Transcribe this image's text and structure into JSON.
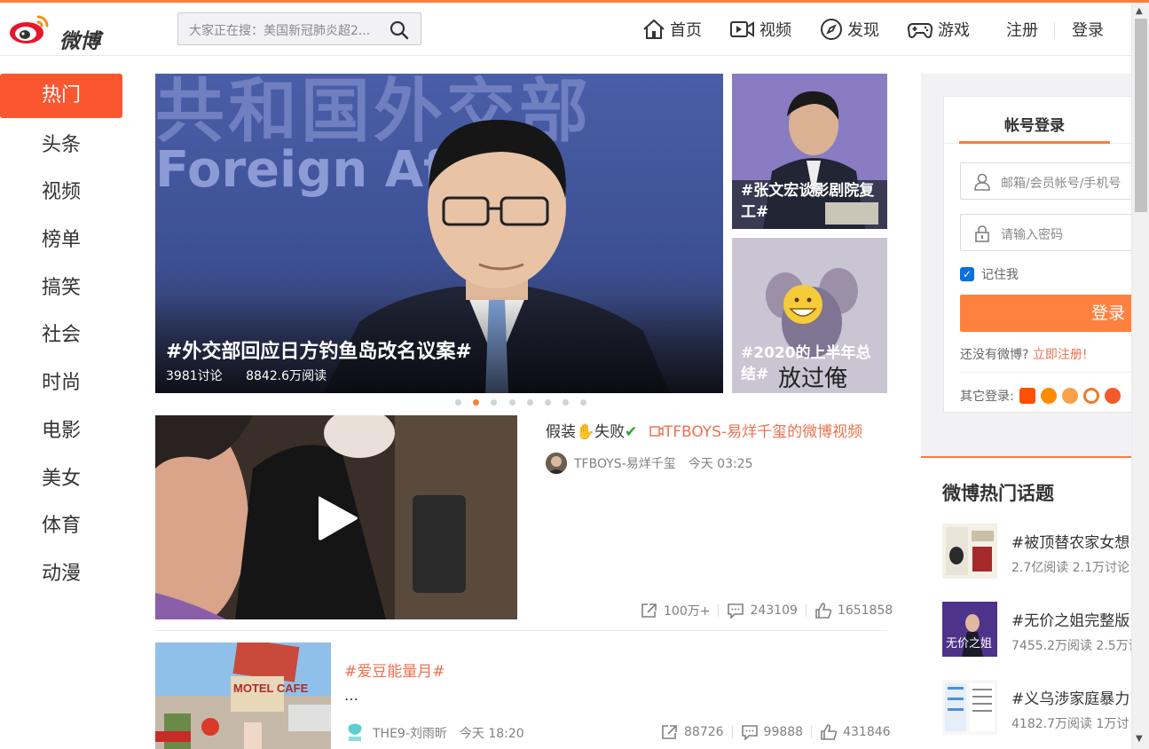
{
  "logo": {
    "text": "微博"
  },
  "search": {
    "placeholder": "大家正在搜：美国新冠肺炎超2..."
  },
  "nav": {
    "home": "首页",
    "video": "视频",
    "discover": "发现",
    "game": "游戏",
    "register": "注册",
    "login": "登录"
  },
  "left_nav": [
    "热门",
    "头条",
    "视频",
    "榜单",
    "搞笑",
    "社会",
    "时尚",
    "电影",
    "美女",
    "体育",
    "动漫"
  ],
  "hero": {
    "main_title": "#外交部回应日方钓鱼岛改名议案#",
    "discussions": "3981讨论",
    "reads": "8842.6万阅读",
    "bg_text_1": "共和国外交部",
    "bg_text_2": "Foreign Af",
    "side1_title": "#张文宏谈影剧院复工#",
    "side2_title": "#2020的上半年总结#",
    "side2_caption": "放过俺",
    "dot_count": 8,
    "active_dot": 2
  },
  "video_card": {
    "title_prefix": "假装",
    "title_fail": "失败",
    "link": "TFBOYS-易烊千玺的微博视频",
    "author": "TFBOYS-易烊千玺",
    "time": "今天 03:25",
    "shares": "100万+",
    "comments": "243109",
    "likes": "1651858"
  },
  "card2": {
    "title": "#爱豆能量月#",
    "excerpt": "…",
    "author": "THE9-刘雨昕",
    "time": "今天 18:20",
    "shares": "88726",
    "comments": "99888",
    "likes": "431846",
    "sign_text": "MOTEL CAFE"
  },
  "login": {
    "tab": "帐号登录",
    "username_placeholder": "邮箱/会员帐号/手机号",
    "password_placeholder": "请输入密码",
    "remember": "记住我",
    "button": "登录",
    "no_account": "还没有微博?",
    "register_link": "立即注册!",
    "other_login": "其它登录:"
  },
  "hot_topics": {
    "title": "微博热门话题",
    "items": [
      {
        "name": "#被顶替农家女想",
        "meta": "2.7亿阅读 2.1万讨论"
      },
      {
        "name": "#无价之姐完整版",
        "meta": "7455.2万阅读 2.5万讨"
      },
      {
        "name": "#义乌涉家庭暴力",
        "meta": "4182.7万阅读 1万讨"
      }
    ],
    "item2_overlay": "无价之姐"
  },
  "colors": {
    "accent": "#fa7d3c",
    "link": "#eb7350",
    "active_nav": "#fa5630"
  }
}
